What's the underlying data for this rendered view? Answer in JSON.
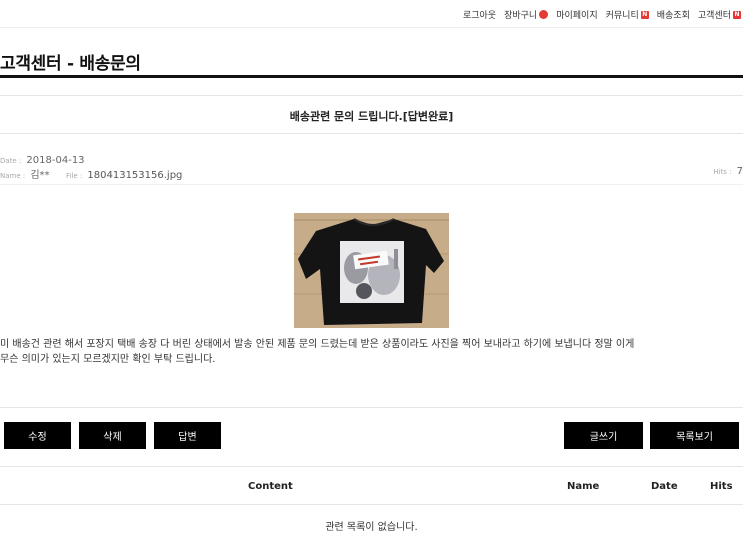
{
  "top_nav": {
    "logout": "로그아웃",
    "cart": "장바구니",
    "mypage": "마이페이지",
    "community": "커뮤니티",
    "delivery_lookup": "배송조회",
    "customer_center": "고객센터",
    "badge_letter": "N"
  },
  "page": {
    "title": "고객센터 - 배송문의"
  },
  "post": {
    "subject": "배송관련 문의 드립니다.[답변완료]",
    "date_label": "Date :",
    "date": "2018-04-13",
    "name_label": "Name :",
    "name": "김**",
    "file_label": "File :",
    "file": "180413153156.jpg",
    "hits_label": "Hits :",
    "hits": "7",
    "body_line1": "미 배송건 관련 해서 포장지 택배 송장 다 버린 상태에서 발송 안된 제품 문의 드렸는데 받은 상품이라도 사진을 찍어 보내라고 하기에 보냅니다 정말 이게",
    "body_line2": "무슨 의미가 있는지 모르겠지만 확인 부탁 드립니다."
  },
  "buttons": {
    "edit": "수정",
    "delete": "삭제",
    "reply": "답변",
    "write": "글쓰기",
    "list": "목록보기"
  },
  "related": {
    "columns": [
      "Content",
      "Name",
      "Date",
      "Hits"
    ],
    "empty_message": "관련 목록이 없습니다."
  },
  "colors": {
    "badge": "#e53935",
    "button_bg": "#000000",
    "title_rule": "#111111"
  }
}
